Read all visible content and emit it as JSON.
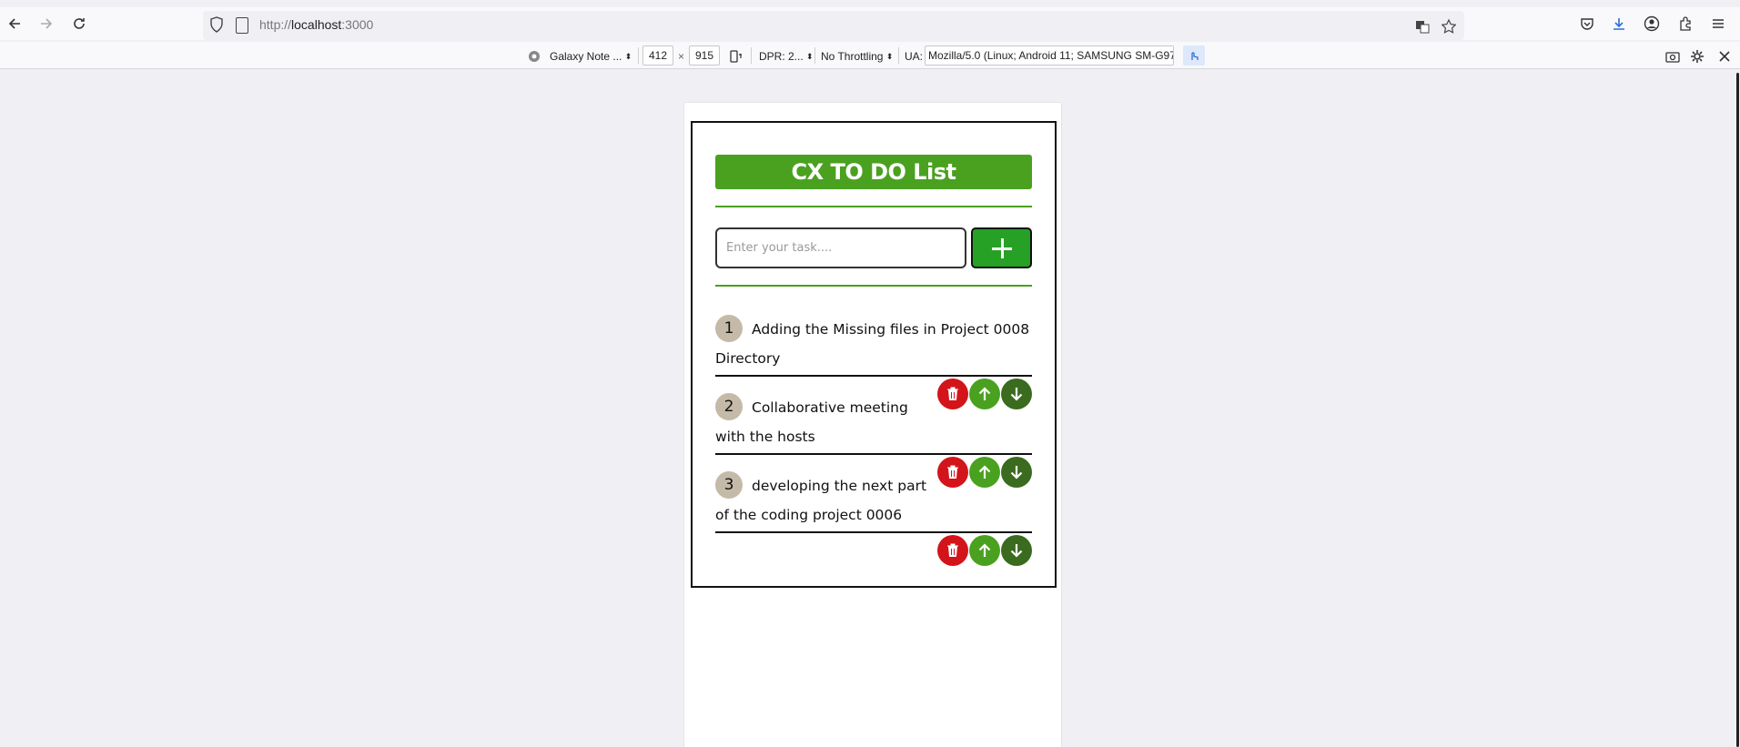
{
  "browser": {
    "url_prefix": "http://",
    "url_host": "localhost",
    "url_suffix": ":3000"
  },
  "rdm": {
    "device": "Galaxy Note ...",
    "width": "412",
    "times": "×",
    "height": "915",
    "dpr": "DPR: 2...",
    "throttling": "No Throttling",
    "ua_label": "UA:",
    "ua_value": "Mozilla/5.0 (Linux; Android 11; SAMSUNG SM-G97"
  },
  "app": {
    "title": "CX TO DO List",
    "input_placeholder": "Enter your task....",
    "add_label": "+",
    "accent": "#4aa120",
    "delete_color": "#d3141b",
    "down_color": "#3b6b1e",
    "tasks": [
      {
        "num": "1",
        "text": "Adding the Missing files in Project 0008 Directory"
      },
      {
        "num": "2",
        "text": "Collaborative meeting with the hosts"
      },
      {
        "num": "3",
        "text": "developing the next part of the coding project 0006"
      }
    ]
  }
}
